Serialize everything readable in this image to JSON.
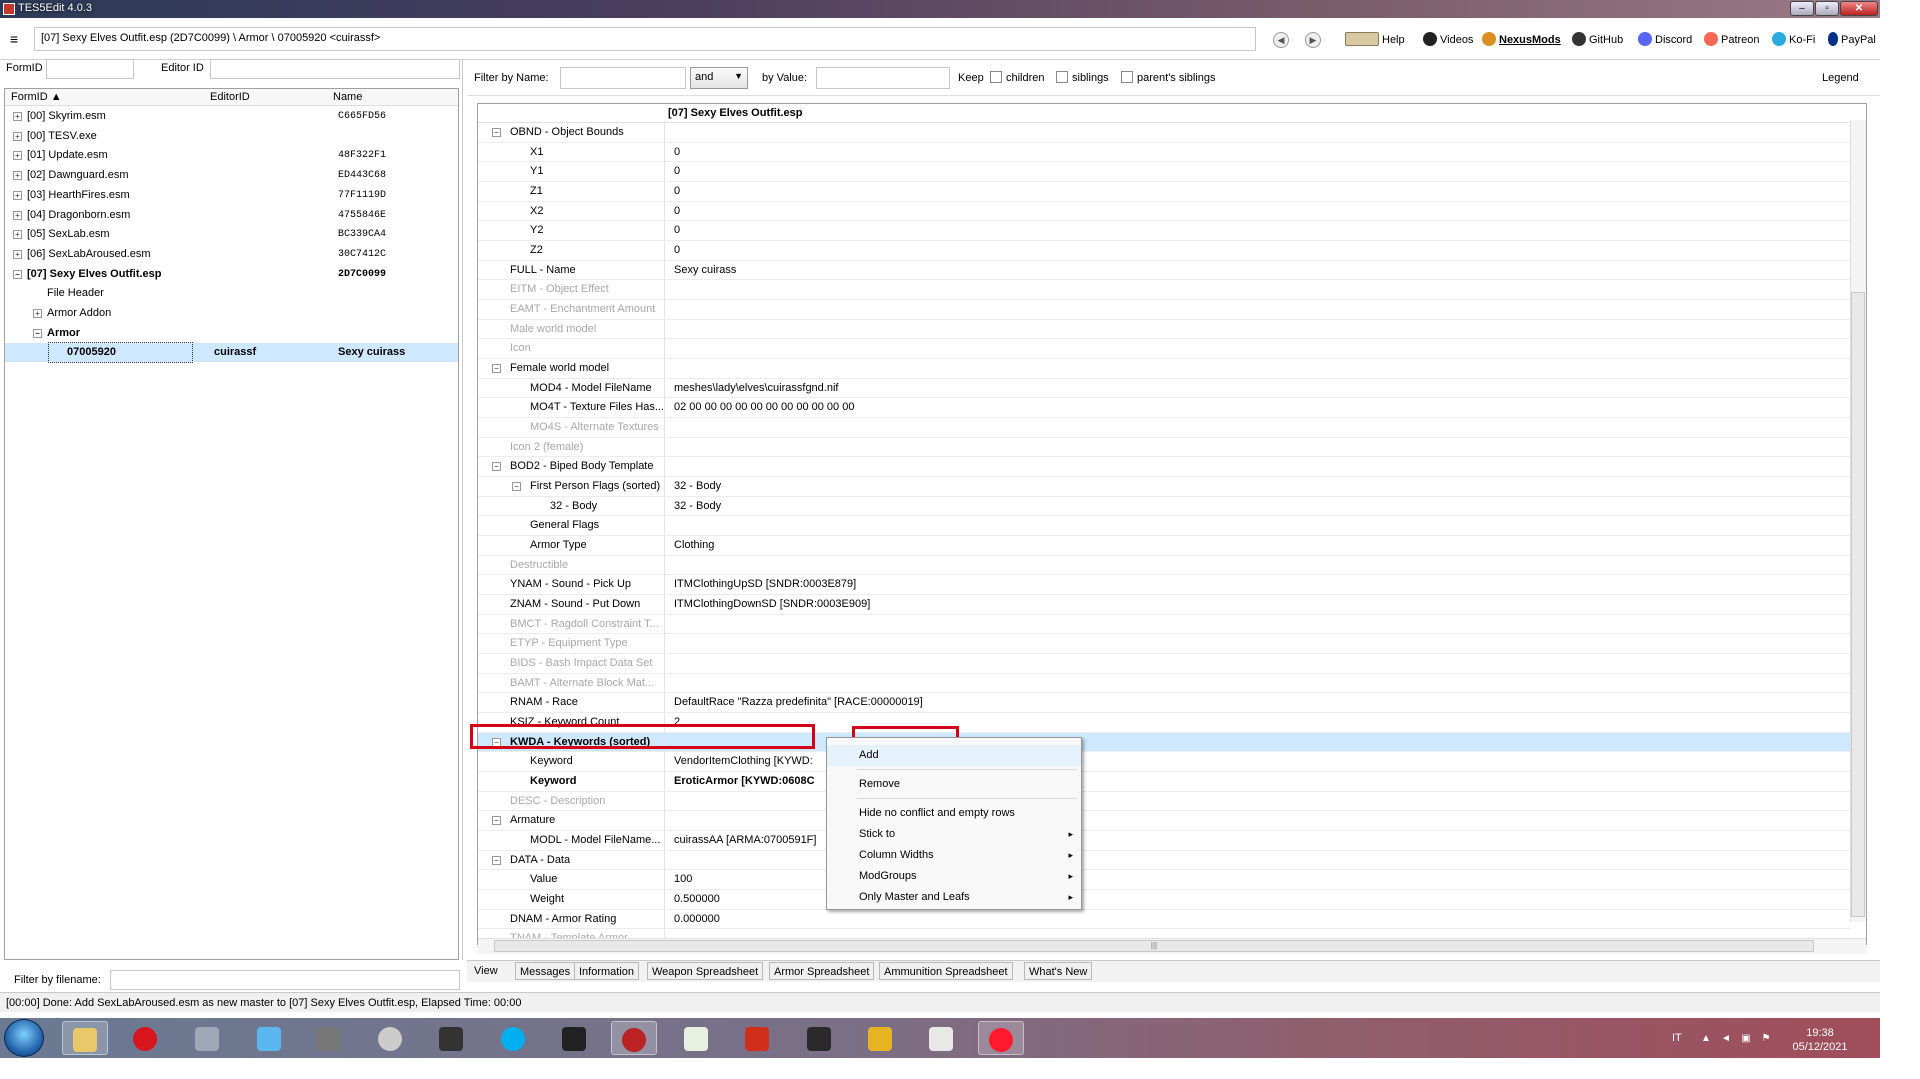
{
  "window": {
    "title": "TES5Edit 4.0.3",
    "min": "‒",
    "max": "▫",
    "close": "✕"
  },
  "addressbar": {
    "path": "[07] Sexy Elves Outfit.esp (2D7C0099) \\ Armor \\ 07005920 <cuirassf>",
    "links": [
      "Help",
      "Videos",
      "NexusMods",
      "GitHub",
      "Discord",
      "Patreon",
      "Ko-Fi",
      "PayPal"
    ]
  },
  "left": {
    "formid_label": "FormID",
    "editorid_label": "Editor ID",
    "headers": [
      "FormID",
      "EditorID",
      "Name"
    ],
    "rows": [
      {
        "c1": "[00] Skyrim.esm",
        "c2": "",
        "c3": "C665FD56",
        "indent": 0,
        "exp": "+"
      },
      {
        "c1": "[00] TESV.exe",
        "c2": "",
        "c3": "",
        "indent": 0,
        "exp": "+"
      },
      {
        "c1": "[01] Update.esm",
        "c2": "",
        "c3": "48F322F1",
        "indent": 0,
        "exp": "+"
      },
      {
        "c1": "[02] Dawnguard.esm",
        "c2": "",
        "c3": "ED443C68",
        "indent": 0,
        "exp": "+"
      },
      {
        "c1": "[03] HearthFires.esm",
        "c2": "",
        "c3": "77F1119D",
        "indent": 0,
        "exp": "+"
      },
      {
        "c1": "[04] Dragonborn.esm",
        "c2": "",
        "c3": "4755846E",
        "indent": 0,
        "exp": "+"
      },
      {
        "c1": "[05] SexLab.esm",
        "c2": "",
        "c3": "BC339CA4",
        "indent": 0,
        "exp": "+"
      },
      {
        "c1": "[06] SexLabAroused.esm",
        "c2": "",
        "c3": "30C7412C",
        "indent": 0,
        "exp": "+"
      },
      {
        "c1": "[07] Sexy Elves Outfit.esp",
        "c2": "",
        "c3": "2D7C0099",
        "indent": 0,
        "exp": "−",
        "bold": true
      },
      {
        "c1": "File Header",
        "c2": "",
        "c3": "",
        "indent": 1,
        "exp": ""
      },
      {
        "c1": "Armor Addon",
        "c2": "",
        "c3": "",
        "indent": 1,
        "exp": "+"
      },
      {
        "c1": "Armor",
        "c2": "",
        "c3": "",
        "indent": 1,
        "exp": "−",
        "bold": true
      },
      {
        "c1": "07005920",
        "c2": "cuirassf",
        "c3": "Sexy cuirass",
        "indent": 2,
        "exp": "",
        "bold": true,
        "selected": true
      }
    ],
    "filter_label": "Filter by filename:"
  },
  "filter": {
    "by_name": "Filter by Name:",
    "and": "and",
    "by_value": "by Value:",
    "keep": "Keep",
    "children": "children",
    "siblings": "siblings",
    "parents_siblings": "parent's siblings",
    "legend": "Legend"
  },
  "grid": {
    "header": "[07] Sexy Elves Outfit.esp",
    "rows": [
      {
        "name": "OBND - Object Bounds",
        "value": "",
        "level": 0,
        "exp": "−"
      },
      {
        "name": "X1",
        "value": "0",
        "level": 1
      },
      {
        "name": "Y1",
        "value": "0",
        "level": 1
      },
      {
        "name": "Z1",
        "value": "0",
        "level": 1
      },
      {
        "name": "X2",
        "value": "0",
        "level": 1
      },
      {
        "name": "Y2",
        "value": "0",
        "level": 1
      },
      {
        "name": "Z2",
        "value": "0",
        "level": 1
      },
      {
        "name": "FULL - Name",
        "value": "Sexy cuirass",
        "level": 0
      },
      {
        "name": "EITM - Object Effect",
        "value": "",
        "level": 0,
        "grey": true
      },
      {
        "name": "EAMT - Enchantment Amount",
        "value": "",
        "level": 0,
        "grey": true
      },
      {
        "name": "Male world model",
        "value": "",
        "level": 0,
        "grey": true
      },
      {
        "name": "Icon",
        "value": "",
        "level": 0,
        "grey": true
      },
      {
        "name": "Female world model",
        "value": "",
        "level": 0,
        "exp": "−"
      },
      {
        "name": "MOD4 - Model FileName",
        "value": "meshes\\lady\\elves\\cuirassfgnd.nif",
        "level": 1
      },
      {
        "name": "MO4T - Texture Files Has...",
        "value": "02 00 00 00 00 00 00 00 00 00 00 00",
        "level": 1
      },
      {
        "name": "MO4S - Alternate Textures",
        "value": "",
        "level": 1,
        "grey": true
      },
      {
        "name": "Icon 2 (female)",
        "value": "",
        "level": 0,
        "grey": true
      },
      {
        "name": "BOD2 - Biped Body Template",
        "value": "",
        "level": 0,
        "exp": "−"
      },
      {
        "name": "First Person Flags (sorted)",
        "value": "32 - Body",
        "level": 1,
        "exp": "−"
      },
      {
        "name": "32 - Body",
        "value": "32 - Body",
        "level": 2
      },
      {
        "name": "General Flags",
        "value": "",
        "level": 1
      },
      {
        "name": "Armor Type",
        "value": "Clothing",
        "level": 1
      },
      {
        "name": "Destructible",
        "value": "",
        "level": 0,
        "grey": true
      },
      {
        "name": "YNAM - Sound - Pick Up",
        "value": "ITMClothingUpSD [SNDR:0003E879]",
        "level": 0
      },
      {
        "name": "ZNAM - Sound - Put Down",
        "value": "ITMClothingDownSD [SNDR:0003E909]",
        "level": 0
      },
      {
        "name": "BMCT - Ragdoll Constraint T...",
        "value": "",
        "level": 0,
        "grey": true
      },
      {
        "name": "ETYP - Equipment Type",
        "value": "",
        "level": 0,
        "grey": true
      },
      {
        "name": "BIDS - Bash Impact Data Set",
        "value": "",
        "level": 0,
        "grey": true
      },
      {
        "name": "BAMT - Alternate Block Mat...",
        "value": "",
        "level": 0,
        "grey": true
      },
      {
        "name": "RNAM - Race",
        "value": "DefaultRace \"Razza predefinita\" [RACE:00000019]",
        "level": 0
      },
      {
        "name": "KSIZ - Keyword Count",
        "value": "2",
        "level": 0
      },
      {
        "name": "KWDA - Keywords (sorted)",
        "value": "",
        "level": 0,
        "exp": "−",
        "bold": true,
        "hl": true
      },
      {
        "name": "Keyword",
        "value": "VendorItemClothing [KYWD:",
        "level": 1
      },
      {
        "name": "Keyword",
        "value": "EroticArmor [KYWD:0608C",
        "level": 1,
        "bold": true
      },
      {
        "name": "DESC - Description",
        "value": "",
        "level": 0,
        "grey": true
      },
      {
        "name": "Armature",
        "value": "",
        "level": 0,
        "exp": "−"
      },
      {
        "name": "MODL - Model FileName...",
        "value": "cuirassAA [ARMA:0700591F]",
        "level": 1
      },
      {
        "name": "DATA - Data",
        "value": "",
        "level": 0,
        "exp": "−"
      },
      {
        "name": "Value",
        "value": "100",
        "level": 1
      },
      {
        "name": "Weight",
        "value": "0.500000",
        "level": 1
      },
      {
        "name": "DNAM - Armor Rating",
        "value": "0.000000",
        "level": 0
      },
      {
        "name": "TNAM - Template Armor",
        "value": "",
        "level": 0,
        "grey": true
      }
    ]
  },
  "context_menu": {
    "items": [
      {
        "label": "Add",
        "sub": false
      },
      {
        "label": "Remove",
        "sub": false
      },
      {
        "label": "Hide no conflict and empty rows",
        "sub": false
      },
      {
        "label": "Stick to",
        "sub": true
      },
      {
        "label": "Column Widths",
        "sub": true
      },
      {
        "label": "ModGroups",
        "sub": true
      },
      {
        "label": "Only Master and Leafs",
        "sub": true
      }
    ],
    "arrow": "▸"
  },
  "tabs": [
    "View",
    "Messages",
    "Information",
    "Weapon Spreadsheet",
    "Armor Spreadsheet",
    "Ammunition Spreadsheet",
    "What's New"
  ],
  "status": "[00:00] Done: Add SexLabAroused.esm as new master to [07] Sexy Elves Outfit.esp, Elapsed Time: 00:00",
  "taskbar": {
    "lang": "IT",
    "time": "19:38",
    "date": "05/12/2021",
    "apps": [
      "explorer",
      "opera",
      "media-center",
      "itunes",
      "volume",
      "ffdec",
      "ableton",
      "skype",
      "nmm",
      "tes5edit",
      "notepad",
      "foxit",
      "sword",
      "chart",
      "skyrim",
      "opera-red"
    ]
  },
  "colors": {
    "accent_highlight": "#cde8ff",
    "red_box": "#d4001a"
  }
}
